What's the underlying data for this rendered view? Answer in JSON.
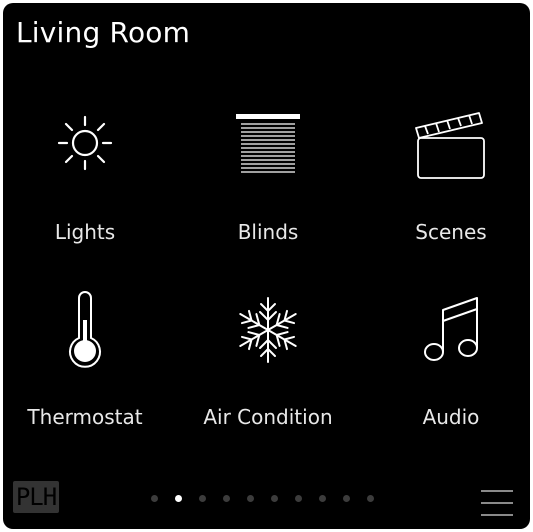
{
  "header": {
    "title": "Living Room"
  },
  "tiles": [
    {
      "label": "Lights",
      "icon": "sun-icon"
    },
    {
      "label": "Blinds",
      "icon": "blinds-icon"
    },
    {
      "label": "Scenes",
      "icon": "clapperboard-icon"
    },
    {
      "label": "Thermostat",
      "icon": "thermometer-icon"
    },
    {
      "label": "Air Condition",
      "icon": "snowflake-icon"
    },
    {
      "label": "Audio",
      "icon": "music-note-icon"
    }
  ],
  "footer": {
    "logo_text": "PLH",
    "page_count": 10,
    "active_page": 2
  },
  "colors": {
    "background": "#000000",
    "text": "#ffffff",
    "inactive_dot": "#3c3c3c",
    "logo_bg": "#333333"
  }
}
